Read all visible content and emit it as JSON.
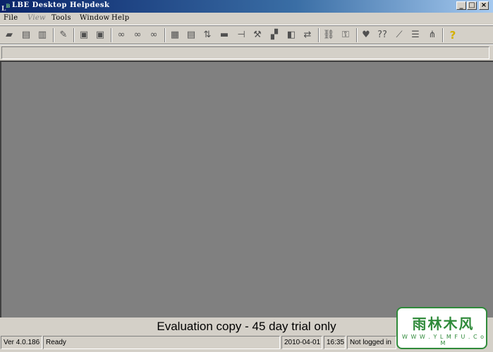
{
  "window": {
    "title": "LBE Desktop Helpdesk",
    "controls": [
      "_",
      "□",
      "×"
    ]
  },
  "menu": [
    {
      "label": "File",
      "enabled": true
    },
    {
      "label": "View",
      "enabled": false
    },
    {
      "label": "Tools",
      "enabled": true
    },
    {
      "label": "Window",
      "enabled": true
    },
    {
      "label": "Help",
      "enabled": true
    }
  ],
  "toolbar": {
    "groups": [
      [
        "open-folder-icon",
        "list-icon",
        "preview-icon"
      ],
      [
        "edit-icon"
      ],
      [
        "save-icon",
        "save-as-icon"
      ],
      [
        "binoculars-find-icon",
        "binoculars-find-next-icon",
        "binoculars-find-prev-icon"
      ],
      [
        "grid-icon",
        "table-icon",
        "sort-az-icon",
        "align-icon",
        "split-icon",
        "hammer-icon",
        "tools-icon",
        "stack-icon",
        "swap-icon"
      ],
      [
        "link-icon",
        "key-icon"
      ],
      [
        "heart-icon",
        "help-question-icon",
        "chart-icon",
        "list-view-icon",
        "tree-icon"
      ],
      [
        "help-icon"
      ]
    ],
    "glyphs": {
      "question": "??",
      "help": "?"
    }
  },
  "banner": "Evaluation copy - 45 day trial only",
  "status": {
    "version": "Ver 4.0.186",
    "state": "Ready",
    "date": "2010-04-01",
    "time": "16:35",
    "login": "Not logged in"
  },
  "watermark": {
    "brand": "雨林木风",
    "url": "W W W . Y L M F U . C o M"
  },
  "colors": {
    "face": "#d4d0c8",
    "workspace": "#808080",
    "title_start": "#0a246a",
    "title_end": "#a6caf0",
    "watermark_green": "#2f8a3a"
  }
}
